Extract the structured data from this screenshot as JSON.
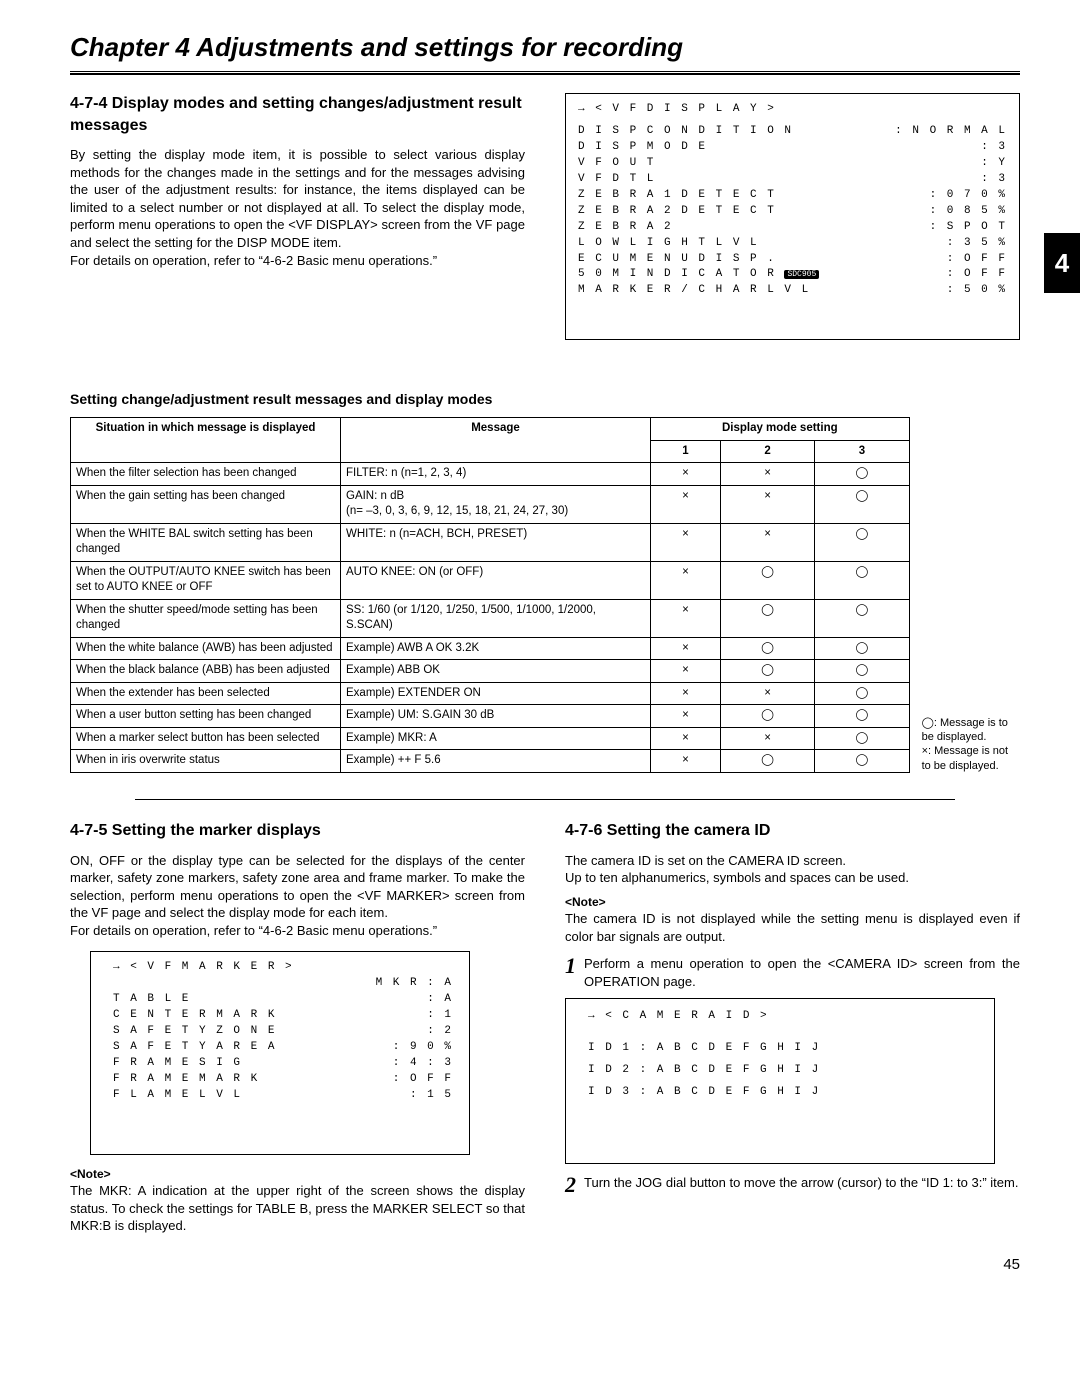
{
  "chapter": "Chapter 4  Adjustments and settings for recording",
  "tab": "4",
  "sec474": {
    "title": "4-7-4 Display modes and setting changes/adjustment result messages",
    "para1": "By setting the display mode item, it is possible to select various display methods for the changes made in the settings and for the messages advising the user of the adjustment results: for instance, the items displayed can be limited to a select number or not displayed at all.  To select the display mode, perform menu operations to open the <VF DISPLAY> screen from the VF page and select the setting for the DISP MODE item.",
    "para2": "For details on operation, refer to “4-6-2 Basic menu operations.”"
  },
  "vf_display": {
    "title": "→ <  V F   D I S P L A Y  >",
    "items": [
      {
        "l": "D I S P   C O N D I T I O N",
        "v": ": N O R M A L"
      },
      {
        "l": "D I S P   M O D E",
        "v": ": 3"
      },
      {
        "l": "V F   O U T",
        "v": ": Y"
      },
      {
        "l": "V F   D T L",
        "v": ": 3"
      },
      {
        "l": "Z E B R A 1   D E T E C T",
        "v": ": 0 7 0 %"
      },
      {
        "l": "Z E B R A 2   D E T E C T",
        "v": ": 0 8 5 %"
      },
      {
        "l": "Z E B R A 2",
        "v": ": S P O T"
      },
      {
        "l": "L O W   L I G H T   L V L",
        "v": ": 3 5 %"
      },
      {
        "l": "E C U   M E N U   D I S P .",
        "v": ": O F F"
      },
      {
        "l": "5 0 M   I N D I C A T O R",
        "tag": "SDC905",
        "v": ": O F F"
      },
      {
        "l": "M A R K E R / C H A R   L V L",
        "v": ": 5 0 %"
      }
    ]
  },
  "table": {
    "title": "Setting change/adjustment result messages and display modes",
    "head_situation": "Situation in which message is displayed",
    "head_message": "Message",
    "head_mode": "Display mode setting",
    "m1": "1",
    "m2": "2",
    "m3": "3",
    "rows": [
      {
        "s": "When the filter selection has been changed",
        "m": "FILTER: n (n=1, 2, 3, 4)",
        "a": "×",
        "b": "×",
        "c": "◯"
      },
      {
        "s": "When the gain setting has been changed",
        "m": "GAIN: n dB\n(n= –3, 0, 3, 6, 9, 12, 15, 18, 21, 24, 27, 30)",
        "a": "×",
        "b": "×",
        "c": "◯"
      },
      {
        "s": "When the WHITE BAL switch setting has been changed",
        "m": "WHITE: n (n=ACH, BCH, PRESET)",
        "a": "×",
        "b": "×",
        "c": "◯"
      },
      {
        "s": "When the OUTPUT/AUTO KNEE switch has been set to AUTO KNEE or OFF",
        "m": "AUTO KNEE: ON (or OFF)",
        "a": "×",
        "b": "◯",
        "c": "◯"
      },
      {
        "s": "When the shutter speed/mode setting has been changed",
        "m": "SS: 1/60 (or 1/120, 1/250, 1/500, 1/1000, 1/2000, S.SCAN)",
        "a": "×",
        "b": "◯",
        "c": "◯"
      },
      {
        "s": "When the white balance (AWB) has been adjusted",
        "m": "Example) AWB A OK 3.2K",
        "a": "×",
        "b": "◯",
        "c": "◯"
      },
      {
        "s": "When the black balance (ABB) has been adjusted",
        "m": "Example) ABB OK",
        "a": "×",
        "b": "◯",
        "c": "◯"
      },
      {
        "s": "When the extender has been selected",
        "m": "Example) EXTENDER ON",
        "a": "×",
        "b": "×",
        "c": "◯"
      },
      {
        "s": "When a user button setting has been changed",
        "m": "Example) UM: S.GAIN 30 dB",
        "a": "×",
        "b": "◯",
        "c": "◯"
      },
      {
        "s": "When a marker select button has been selected",
        "m": "Example) MKR: A",
        "a": "×",
        "b": "×",
        "c": "◯"
      },
      {
        "s": "When in iris overwrite status",
        "m": "Example) ++ F 5.6",
        "a": "×",
        "b": "◯",
        "c": "◯"
      }
    ],
    "legend_o": "◯: Message is to be displayed.",
    "legend_x": "×: Message is not to be displayed."
  },
  "sec475": {
    "title": "4-7-5 Setting the marker displays",
    "para1": "ON, OFF or the display type can be selected for the displays of the center marker, safety zone markers, safety zone area and frame marker.  To make the selection, perform menu operations to open the <VF MARKER> screen from the VF page and select the display mode for each item.",
    "para2": "For details on operation, refer to “4-6-2 Basic menu operations.”",
    "note_lbl": "<Note>",
    "note": "The MKR: A indication at the upper right of the screen shows the display status. To check the settings for TABLE B, press the MARKER SELECT so that MKR:B is displayed."
  },
  "vf_marker": {
    "title": "→ <  V F   M A R K E R  >",
    "topright": "M K R : A",
    "items": [
      {
        "l": "T A B L E",
        "v": ": A"
      },
      {
        "l": "C E N T E R   M A R K",
        "v": ": 1"
      },
      {
        "l": "S A F E T Y   Z O N E",
        "v": ": 2"
      },
      {
        "l": "S A F E T Y   A R E A",
        "v": ": 9 0 %"
      },
      {
        "l": "F R A M E   S I G",
        "v": ": 4 : 3"
      },
      {
        "l": "F R A M E   M A R K",
        "v": ": O F F"
      },
      {
        "l": "F L A M E   L V L",
        "v": ": 1 5"
      }
    ]
  },
  "sec476": {
    "title": "4-7-6 Setting the camera ID",
    "para1": "The camera ID is set on the CAMERA ID screen.",
    "para2": "Up to ten alphanumerics, symbols and spaces can be used.",
    "note_lbl": "<Note>",
    "note": "The camera ID is not displayed while the setting menu is displayed even if color bar signals are output.",
    "step1": "Perform a menu operation to open the <CAMERA ID> screen from the OPERATION page.",
    "step2": "Turn the JOG dial button to move the arrow (cursor) to the “ID 1: to 3:” item."
  },
  "camera_id": {
    "title": "→ <  C A M E R A   I D  >",
    "items": [
      "I D 1   :   A B C D E F G H I J",
      "I D 2   :   A B C D E F G H I J",
      "I D 3   :   A B C D E F G H I J"
    ]
  },
  "pageno": "45"
}
